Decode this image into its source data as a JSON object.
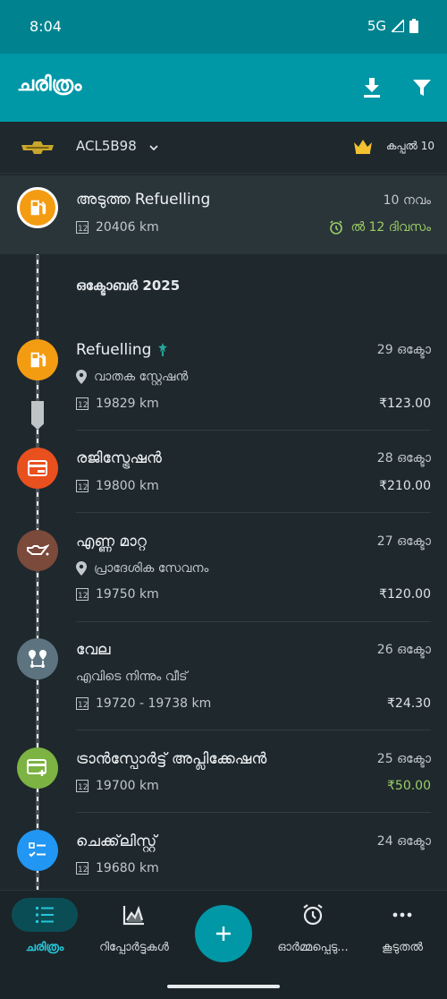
{
  "status": {
    "time": "8:04",
    "network": "5G"
  },
  "appbar": {
    "title": "ചരിത്രം",
    "download_icon": "download-icon",
    "filter_icon": "filter-icon"
  },
  "vehicle": {
    "name": "ACL5B98",
    "tier": "കപ്പൽ 10"
  },
  "upcoming": {
    "title": "അടുത്ത Refuelling",
    "date": "10 നവം",
    "odometer": "20406 km",
    "due": "ൽ 12 ദിവസം"
  },
  "month_header": "ഒക്ടോബർ 2025",
  "entries": [
    {
      "title": "Refuelling",
      "date": "29 ഒക്ടോ",
      "location": "വാതക സ്റ്റേഷൻ",
      "odometer": "19829 km",
      "price": "₹123.00",
      "color": "#f39c12",
      "icon": "fuel-pump-icon"
    },
    {
      "title": "രജിസ്ട്രേഷൻ",
      "date": "28 ഒക്ടോ",
      "odometer": "19800 km",
      "price": "₹210.00",
      "color": "#e8501e",
      "icon": "registration-card-icon"
    },
    {
      "title": "എണ്ണ മാറ്റ",
      "date": "27 ഒക്ടോ",
      "location": "പ്രാദേശിക സേവനം",
      "odometer": "19750 km",
      "price": "₹120.00",
      "color": "#7b4a3a",
      "icon": "oil-can-icon"
    },
    {
      "title": "വേല",
      "date": "26 ഒക്ടോ",
      "note": "എവിടെ നിന്നും വീട്",
      "odometer": "19720 - 19738 km",
      "price": "₹24.30",
      "color": "#5d7480",
      "icon": "route-icon"
    },
    {
      "title": "ട്രാൻസ്പോർട്ട് അപ്ലിക്കേഷൻ",
      "date": "25 ഒക്ടോ",
      "odometer": "19700 km",
      "price": "₹50.00",
      "color": "#7cb342",
      "icon": "card-plus-icon"
    },
    {
      "title": "ചെക്ക്‌ലിസ്റ്റ്",
      "date": "24 ഒക്ടോ",
      "odometer": "19680 km",
      "color": "#2196f3",
      "icon": "checklist-icon"
    }
  ],
  "nav": {
    "history": "ചരിത്രം",
    "reports": "റിപ്പോർട്ടുകൾ",
    "reminders": "ഓർമ്മപ്പെടു...",
    "more": "കൂടുതൽ"
  },
  "colors": {
    "accent": "#0097a7",
    "positive": "#9ccc65",
    "background": "#1e282d"
  }
}
